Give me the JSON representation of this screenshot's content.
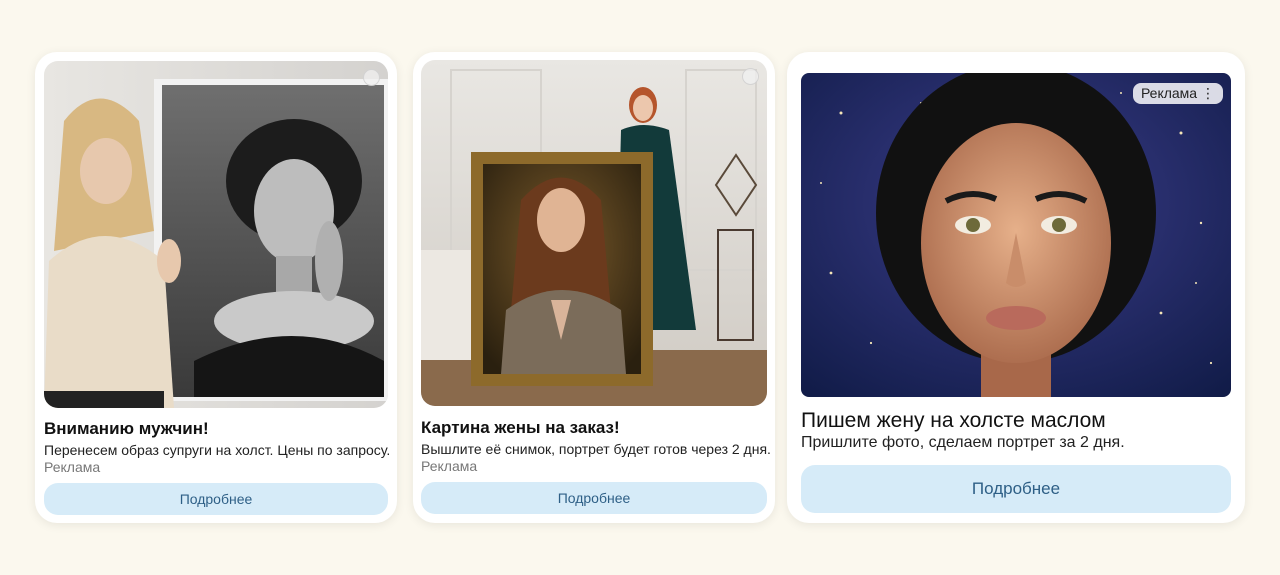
{
  "ads": [
    {
      "title": "Вниманию мужчин!",
      "description": "Перенесем образ супруги на холст. Цены по запросу.",
      "ad_label": "Реклама",
      "button_label": "Подробнее",
      "image_icon": "portrait-photo"
    },
    {
      "title": "Картина жены на заказ!",
      "description": "Вышлите её снимок, портрет будет готов через 2 дня.",
      "ad_label": "Реклама",
      "button_label": "Подробнее",
      "image_icon": "framed-painting-photo"
    },
    {
      "title": "Пишем жену на холсте маслом",
      "description": "Пришлите фото, сделаем портрет за 2 дня.",
      "ad_badge": "Реклама",
      "menu_icon": "more-vertical-icon",
      "button_label": "Подробнее",
      "image_icon": "oil-portrait"
    }
  ],
  "colors": {
    "background": "#fbf8ee",
    "button_bg": "#d6ebf8",
    "button_text": "#2e5f86"
  }
}
